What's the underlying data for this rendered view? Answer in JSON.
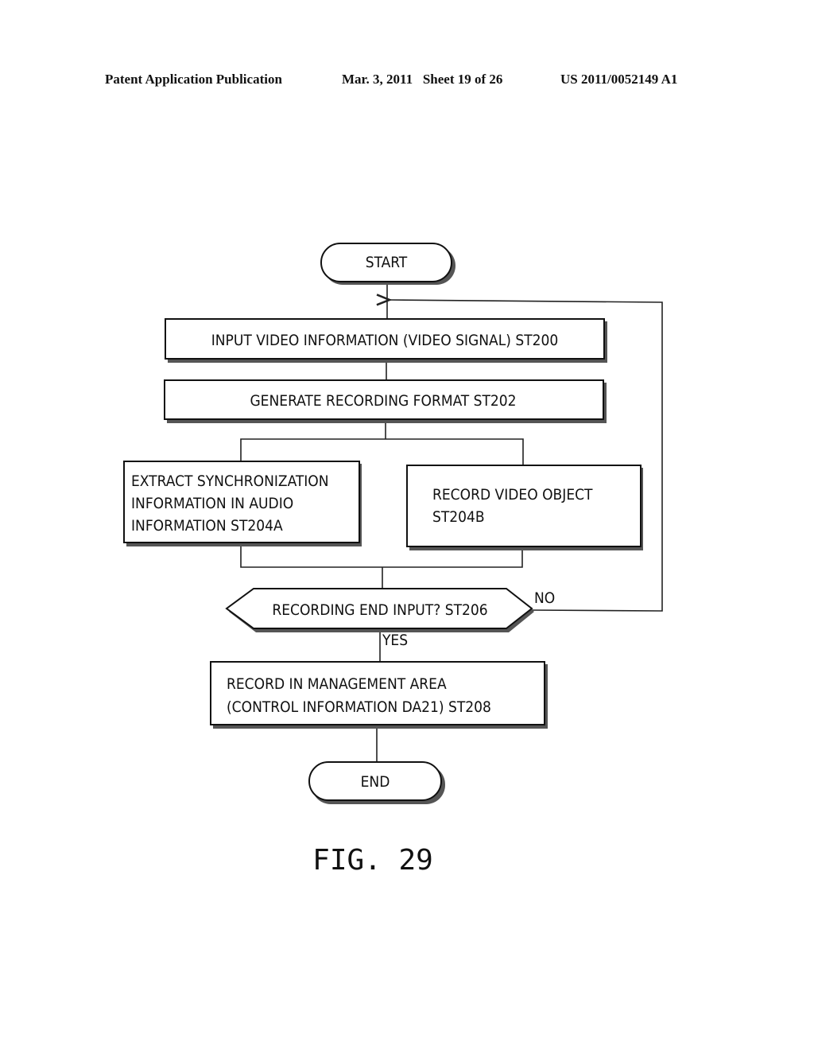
{
  "header": {
    "publication": "Patent Application Publication",
    "date_sheet": "Mar. 3, 2011   Sheet 19 of 26",
    "patent_number": "US 2011/0052149 A1"
  },
  "flowchart": {
    "start": "START",
    "st200": "INPUT VIDEO INFORMATION (VIDEO SIGNAL) ST200",
    "st202": "GENERATE RECORDING FORMAT ST202",
    "st204a": [
      "EXTRACT SYNCHRONIZATION",
      "INFORMATION IN AUDIO",
      "INFORMATION ST204A"
    ],
    "st204b": [
      "RECORD VIDEO OBJECT",
      "ST204B"
    ],
    "st206": "RECORDING END INPUT? ST206",
    "no_label": "NO",
    "yes_label": "YES",
    "st208": [
      "RECORD IN MANAGEMENT AREA",
      "(CONTROL INFORMATION DA21) ST208"
    ],
    "end": "END"
  },
  "figure_label": "FIG. 29"
}
